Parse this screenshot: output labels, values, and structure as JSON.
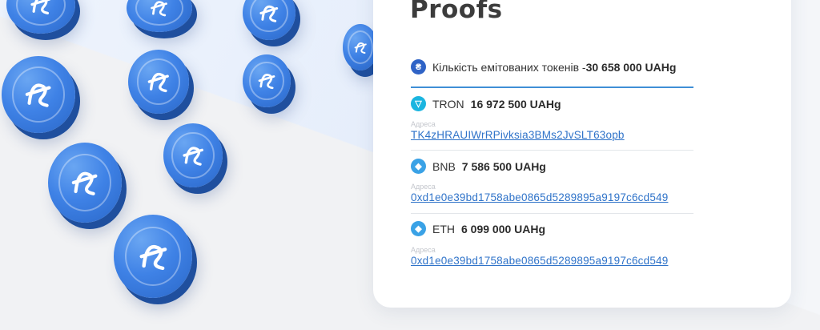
{
  "heading": "Proofs",
  "summary": {
    "icon": "uahg-token-icon",
    "label": "Кількість емітованих токенів - ",
    "value": "30 658 000 UAHg"
  },
  "networks": [
    {
      "icon": "tron-icon",
      "name": "TRON",
      "amount": "16 972 500 UAHg",
      "address_label": "Адреса",
      "address": "TK4zHRAUIWrRPivksia3BMs2JvSLT63opb"
    },
    {
      "icon": "bnb-icon",
      "name": "BNB",
      "amount": "7 586 500 UAHg",
      "address_label": "Адреса",
      "address": "0xd1e0e39bd1758abe0865d5289895a9197c6cd549"
    },
    {
      "icon": "eth-icon",
      "name": "ETH",
      "amount": "6 099 000 UAHg",
      "address_label": "Адреса",
      "address": "0xd1e0e39bd1758abe0865d5289895a9197c6cd549"
    }
  ],
  "colors": {
    "accent": "#2f73c9",
    "coin": "#3f82e6",
    "divider": "#3f8fd6"
  }
}
